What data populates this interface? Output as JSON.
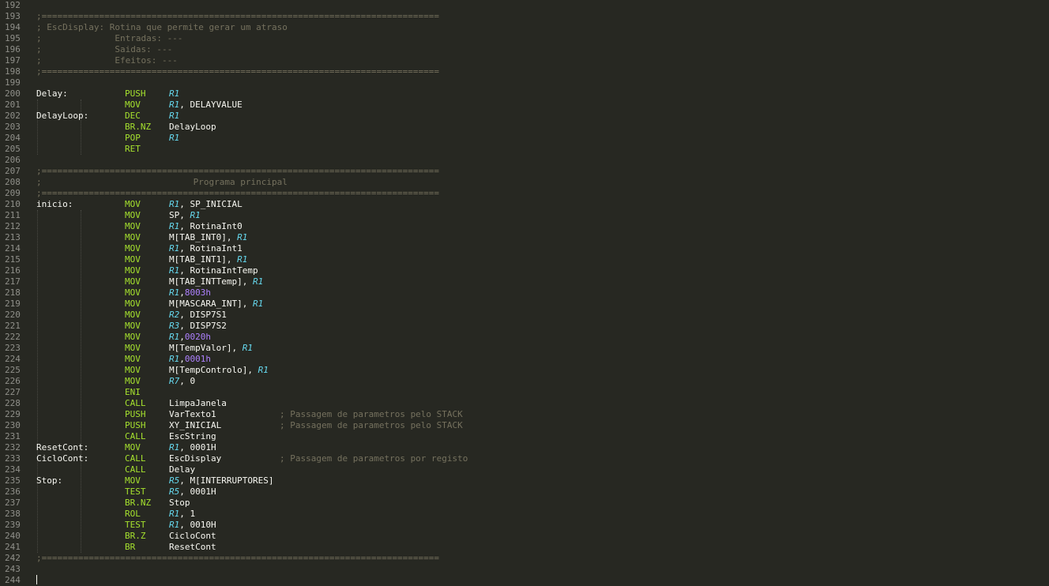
{
  "lines": [
    {
      "n": "192",
      "kind": "blank"
    },
    {
      "n": "193",
      "kind": "comment",
      "text": ";============================================================================"
    },
    {
      "n": "194",
      "kind": "comment",
      "text": "; EscDisplay: Rotina que permite gerar um atraso"
    },
    {
      "n": "195",
      "kind": "comment",
      "text": ";              Entradas: ---"
    },
    {
      "n": "196",
      "kind": "comment",
      "text": ";              Saidas: ---"
    },
    {
      "n": "197",
      "kind": "comment",
      "text": ";              Efeitos: ---"
    },
    {
      "n": "198",
      "kind": "comment",
      "text": ";============================================================================"
    },
    {
      "n": "199",
      "kind": "blank"
    },
    {
      "n": "200",
      "kind": "code",
      "label": "Delay:",
      "op": "PUSH",
      "args": [
        {
          "t": "R1",
          "c": "reg"
        }
      ]
    },
    {
      "n": "201",
      "kind": "code",
      "op": "MOV",
      "args": [
        {
          "t": "R1",
          "c": "reg"
        },
        {
          "t": ", DELAYVALUE"
        }
      ]
    },
    {
      "n": "202",
      "kind": "code",
      "label": "DelayLoop:",
      "op": "DEC",
      "args": [
        {
          "t": "R1",
          "c": "reg"
        }
      ]
    },
    {
      "n": "203",
      "kind": "code",
      "op": "BR.NZ",
      "args": [
        {
          "t": "DelayLoop"
        }
      ]
    },
    {
      "n": "204",
      "kind": "code",
      "op": "POP",
      "args": [
        {
          "t": "R1",
          "c": "reg"
        }
      ]
    },
    {
      "n": "205",
      "kind": "code",
      "op": "RET",
      "args": []
    },
    {
      "n": "206",
      "kind": "blank"
    },
    {
      "n": "207",
      "kind": "comment",
      "text": ";============================================================================"
    },
    {
      "n": "208",
      "kind": "comment",
      "text": ";                             Programa principal"
    },
    {
      "n": "209",
      "kind": "comment",
      "text": ";============================================================================"
    },
    {
      "n": "210",
      "kind": "code",
      "label": "inicio:",
      "op": "MOV",
      "args": [
        {
          "t": "R1",
          "c": "reg"
        },
        {
          "t": ", SP_INICIAL"
        }
      ]
    },
    {
      "n": "211",
      "kind": "code",
      "op": "MOV",
      "args": [
        {
          "t": "SP, "
        },
        {
          "t": "R1",
          "c": "reg"
        }
      ]
    },
    {
      "n": "212",
      "kind": "code",
      "op": "MOV",
      "args": [
        {
          "t": "R1",
          "c": "reg"
        },
        {
          "t": ", RotinaInt0"
        }
      ]
    },
    {
      "n": "213",
      "kind": "code",
      "op": "MOV",
      "args": [
        {
          "t": "M[TAB_INT0], "
        },
        {
          "t": "R1",
          "c": "reg"
        }
      ]
    },
    {
      "n": "214",
      "kind": "code",
      "op": "MOV",
      "args": [
        {
          "t": "R1",
          "c": "reg"
        },
        {
          "t": ", RotinaInt1"
        }
      ]
    },
    {
      "n": "215",
      "kind": "code",
      "op": "MOV",
      "args": [
        {
          "t": "M[TAB_INT1], "
        },
        {
          "t": "R1",
          "c": "reg"
        }
      ]
    },
    {
      "n": "216",
      "kind": "code",
      "op": "MOV",
      "args": [
        {
          "t": "R1",
          "c": "reg"
        },
        {
          "t": ", RotinaIntTemp"
        }
      ]
    },
    {
      "n": "217",
      "kind": "code",
      "op": "MOV",
      "args": [
        {
          "t": "M[TAB_INTTemp], "
        },
        {
          "t": "R1",
          "c": "reg"
        }
      ]
    },
    {
      "n": "218",
      "kind": "code",
      "op": "MOV",
      "args": [
        {
          "t": "R1",
          "c": "reg"
        },
        {
          "t": ","
        },
        {
          "t": "8003h",
          "c": "num"
        }
      ]
    },
    {
      "n": "219",
      "kind": "code",
      "op": "MOV",
      "args": [
        {
          "t": "M[MASCARA_INT], "
        },
        {
          "t": "R1",
          "c": "reg"
        }
      ]
    },
    {
      "n": "220",
      "kind": "code",
      "op": "MOV",
      "args": [
        {
          "t": "R2",
          "c": "reg"
        },
        {
          "t": ", DISP7S1"
        }
      ]
    },
    {
      "n": "221",
      "kind": "code",
      "op": "MOV",
      "args": [
        {
          "t": "R3",
          "c": "reg"
        },
        {
          "t": ", DISP7S2"
        }
      ]
    },
    {
      "n": "222",
      "kind": "code",
      "op": "MOV",
      "args": [
        {
          "t": "R1",
          "c": "reg"
        },
        {
          "t": ","
        },
        {
          "t": "0020h",
          "c": "num"
        }
      ]
    },
    {
      "n": "223",
      "kind": "code",
      "op": "MOV",
      "args": [
        {
          "t": "M[TempValor], "
        },
        {
          "t": "R1",
          "c": "reg"
        }
      ]
    },
    {
      "n": "224",
      "kind": "code",
      "op": "MOV",
      "args": [
        {
          "t": "R1",
          "c": "reg"
        },
        {
          "t": ","
        },
        {
          "t": "0001h",
          "c": "num"
        }
      ]
    },
    {
      "n": "225",
      "kind": "code",
      "op": "MOV",
      "args": [
        {
          "t": "M[TempControlo], "
        },
        {
          "t": "R1",
          "c": "reg"
        }
      ]
    },
    {
      "n": "226",
      "kind": "code",
      "op": "MOV",
      "args": [
        {
          "t": "R7",
          "c": "reg"
        },
        {
          "t": ", 0"
        }
      ]
    },
    {
      "n": "227",
      "kind": "code",
      "op": "ENI",
      "args": []
    },
    {
      "n": "228",
      "kind": "code",
      "op": "CALL",
      "args": [
        {
          "t": "LimpaJanela"
        }
      ]
    },
    {
      "n": "229",
      "kind": "code",
      "op": "PUSH",
      "args": [
        {
          "t": "VarTexto1"
        }
      ],
      "comment": "; Passagem de parametros pelo STACK"
    },
    {
      "n": "230",
      "kind": "code",
      "op": "PUSH",
      "args": [
        {
          "t": "XY_INICIAL"
        }
      ],
      "comment": "; Passagem de parametros pelo STACK"
    },
    {
      "n": "231",
      "kind": "code",
      "op": "CALL",
      "args": [
        {
          "t": "EscString"
        }
      ]
    },
    {
      "n": "232",
      "kind": "code",
      "label": "ResetCont:",
      "op": "MOV",
      "args": [
        {
          "t": "R1",
          "c": "reg"
        },
        {
          "t": ", 0001H"
        }
      ]
    },
    {
      "n": "233",
      "kind": "code",
      "label": "CicloCont:",
      "op": "CALL",
      "args": [
        {
          "t": "EscDisplay"
        }
      ],
      "comment": "; Passagem de parametros por registo"
    },
    {
      "n": "234",
      "kind": "code",
      "op": "CALL",
      "args": [
        {
          "t": "Delay"
        }
      ]
    },
    {
      "n": "235",
      "kind": "code",
      "label": "Stop:",
      "op": "MOV",
      "args": [
        {
          "t": "R5",
          "c": "reg"
        },
        {
          "t": ", M[INTERRUPTORES]"
        }
      ]
    },
    {
      "n": "236",
      "kind": "code",
      "op": "TEST",
      "args": [
        {
          "t": "R5",
          "c": "reg"
        },
        {
          "t": ", 0001H"
        }
      ]
    },
    {
      "n": "237",
      "kind": "code",
      "op": "BR.NZ",
      "args": [
        {
          "t": "Stop"
        }
      ]
    },
    {
      "n": "238",
      "kind": "code",
      "op": "ROL",
      "args": [
        {
          "t": "R1",
          "c": "reg"
        },
        {
          "t": ", 1"
        }
      ]
    },
    {
      "n": "239",
      "kind": "code",
      "op": "TEST",
      "args": [
        {
          "t": "R1",
          "c": "reg"
        },
        {
          "t": ", 0010H"
        }
      ]
    },
    {
      "n": "240",
      "kind": "code",
      "op": "BR.Z",
      "args": [
        {
          "t": "CicloCont"
        }
      ]
    },
    {
      "n": "241",
      "kind": "code",
      "op": "BR",
      "args": [
        {
          "t": "ResetCont"
        }
      ]
    },
    {
      "n": "242",
      "kind": "comment",
      "text": ";============================================================================"
    },
    {
      "n": "243",
      "kind": "blank"
    },
    {
      "n": "244",
      "kind": "blank"
    }
  ]
}
